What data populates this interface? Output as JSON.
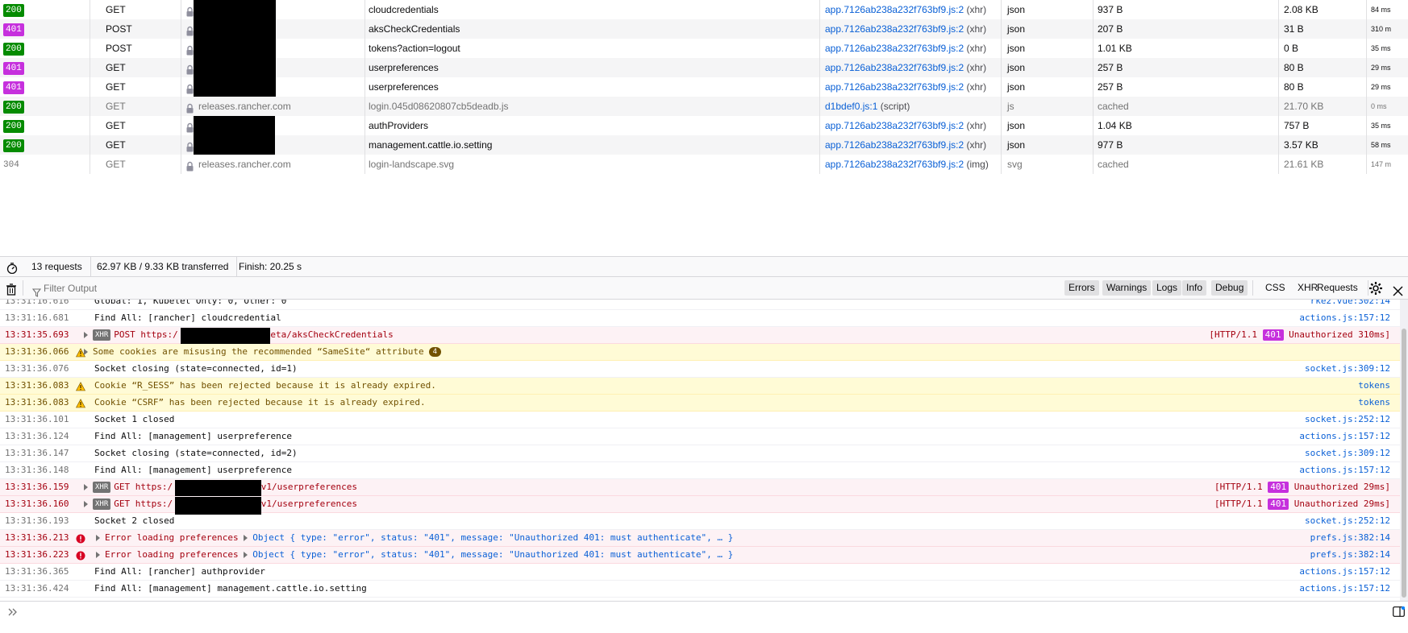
{
  "network": {
    "rows": [
      {
        "status": "200",
        "method": "GET",
        "domain": "",
        "file": "cloudcredentials",
        "initiator": "app.7126ab238a232f763bf9.js:2",
        "initiator_type": "(xhr)",
        "type": "json",
        "transferred": "937 B",
        "size": "2.08 KB",
        "time": "84 ms"
      },
      {
        "status": "401",
        "method": "POST",
        "domain": "",
        "file": "aksCheckCredentials",
        "initiator": "app.7126ab238a232f763bf9.js:2",
        "initiator_type": "(xhr)",
        "type": "json",
        "transferred": "207 B",
        "size": "31 B",
        "time": "310 m"
      },
      {
        "status": "200",
        "method": "POST",
        "domain": "",
        "file": "tokens?action=logout",
        "initiator": "app.7126ab238a232f763bf9.js:2",
        "initiator_type": "(xhr)",
        "type": "json",
        "transferred": "1.01 KB",
        "size": "0 B",
        "time": "35 ms"
      },
      {
        "status": "401",
        "method": "GET",
        "domain": "",
        "file": "userpreferences",
        "initiator": "app.7126ab238a232f763bf9.js:2",
        "initiator_type": "(xhr)",
        "type": "json",
        "transferred": "257 B",
        "size": "80 B",
        "time": "29 ms"
      },
      {
        "status": "401",
        "method": "GET",
        "domain": "",
        "file": "userpreferences",
        "initiator": "app.7126ab238a232f763bf9.js:2",
        "initiator_type": "(xhr)",
        "type": "json",
        "transferred": "257 B",
        "size": "80 B",
        "time": "29 ms"
      },
      {
        "status": "200",
        "method": "GET",
        "domain": "releases.rancher.com",
        "file": "login.045d08620807cb5deadb.js",
        "initiator": "d1bdef0.js:1",
        "initiator_type": "(script)",
        "type": "js",
        "transferred": "cached",
        "size": "21.70 KB",
        "time": "0 ms"
      },
      {
        "status": "200",
        "method": "GET",
        "domain": "",
        "file": "authProviders",
        "initiator": "app.7126ab238a232f763bf9.js:2",
        "initiator_type": "(xhr)",
        "type": "json",
        "transferred": "1.04 KB",
        "size": "757 B",
        "time": "35 ms"
      },
      {
        "status": "200",
        "method": "GET",
        "domain": "",
        "file": "management.cattle.io.setting",
        "initiator": "app.7126ab238a232f763bf9.js:2",
        "initiator_type": "(xhr)",
        "type": "json",
        "transferred": "977 B",
        "size": "3.57 KB",
        "time": "58 ms"
      },
      {
        "status": "304",
        "method": "GET",
        "domain": "releases.rancher.com",
        "file": "login-landscape.svg",
        "initiator": "app.7126ab238a232f763bf9.js:2",
        "initiator_type": "(img)",
        "type": "svg",
        "transferred": "cached",
        "size": "21.61 KB",
        "time": "147 m"
      }
    ]
  },
  "summary": {
    "requests": "13 requests",
    "transferred": "62.97 KB / 9.33 KB transferred",
    "finish": "Finish: 20.25 s"
  },
  "toolbar": {
    "filter_placeholder": "Filter Output",
    "levels": [
      "Errors",
      "Warnings",
      "Logs",
      "Info",
      "Debug"
    ],
    "extra": [
      "CSS",
      "XHR",
      "Requests"
    ]
  },
  "console": {
    "rows": [
      {
        "kind": "log",
        "ts": "13:31:16.616",
        "msg": "Global: 1, Kubelet Only: 0, Other: 0",
        "src": "rke2.vue:302:14"
      },
      {
        "kind": "log",
        "ts": "13:31:16.681",
        "msg": "Find All: [rancher] cloudcredential",
        "src": "actions.js:157:12"
      },
      {
        "kind": "xhr",
        "ts": "13:31:35.693",
        "tag": "XHR",
        "verb": "POST",
        "url_a": "https:/",
        "url_b": "meta/aksCheckCredentials",
        "http": "[HTTP/1.1",
        "code": "401",
        "result": "Unauthorized 310ms]"
      },
      {
        "kind": "warn",
        "ts": "13:31:36.066",
        "msg": "Some cookies are misusing the recommended “SameSite“ attribute",
        "count": "4"
      },
      {
        "kind": "log",
        "ts": "13:31:36.076",
        "msg": "Socket closing (state=connected, id=1)",
        "src": "socket.js:309:12"
      },
      {
        "kind": "warn",
        "ts": "13:31:36.083",
        "msg": "Cookie “R_SESS” has been rejected because it is already expired.",
        "src": "tokens"
      },
      {
        "kind": "warn",
        "ts": "13:31:36.083",
        "msg": "Cookie “CSRF” has been rejected because it is already expired.",
        "src": "tokens"
      },
      {
        "kind": "log",
        "ts": "13:31:36.101",
        "msg": "Socket 1 closed",
        "src": "socket.js:252:12"
      },
      {
        "kind": "log",
        "ts": "13:31:36.124",
        "msg": "Find All: [management] userpreference",
        "src": "actions.js:157:12"
      },
      {
        "kind": "log",
        "ts": "13:31:36.147",
        "msg": "Socket closing (state=connected, id=2)",
        "src": "socket.js:309:12"
      },
      {
        "kind": "log",
        "ts": "13:31:36.148",
        "msg": "Find All: [management] userpreference",
        "src": "actions.js:157:12"
      },
      {
        "kind": "xhr",
        "ts": "13:31:36.159",
        "tag": "XHR",
        "verb": "GET",
        "url_a": "https:/",
        "url_b": "/v1/userpreferences",
        "http": "[HTTP/1.1",
        "code": "401",
        "result": "Unauthorized 29ms]"
      },
      {
        "kind": "xhr",
        "ts": "13:31:36.160",
        "tag": "XHR",
        "verb": "GET",
        "url_a": "https:/",
        "url_b": "/v1/userpreferences",
        "http": "[HTTP/1.1",
        "code": "401",
        "result": "Unauthorized 29ms]"
      },
      {
        "kind": "log",
        "ts": "13:31:36.193",
        "msg": "Socket 2 closed",
        "src": "socket.js:252:12"
      },
      {
        "kind": "error",
        "ts": "13:31:36.213",
        "msg": "Error loading preferences",
        "obj": "Object { type: \"error\", status: \"401\", message: \"Unauthorized 401: must authenticate\", … }",
        "src": "prefs.js:382:14"
      },
      {
        "kind": "error",
        "ts": "13:31:36.223",
        "msg": "Error loading preferences",
        "obj": "Object { type: \"error\", status: \"401\", message: \"Unauthorized 401: must authenticate\", … }",
        "src": "prefs.js:382:14"
      },
      {
        "kind": "log",
        "ts": "13:31:36.365",
        "msg": "Find All: [rancher] authprovider",
        "src": "actions.js:157:12"
      },
      {
        "kind": "log",
        "ts": "13:31:36.424",
        "msg": "Find All: [management] management.cattle.io.setting",
        "src": "actions.js:157:12"
      }
    ]
  },
  "icons": {
    "lock": "lock-icon",
    "timer": "timer-icon",
    "trash": "trash-icon",
    "filter": "filter-icon",
    "gear": "gear-icon",
    "close": "close-icon",
    "prompt": "chevrons-right-icon",
    "sidebar": "sidebar-toggle-icon",
    "warning": "warning-icon",
    "error": "error-icon",
    "expand": "expand-triangle-icon"
  },
  "colors": {
    "ok": "#058b00",
    "unauthorized": "#c630dd",
    "link": "#0a60d6",
    "warn_bg": "#fffbd6",
    "error_bg": "#fdf2f5"
  }
}
